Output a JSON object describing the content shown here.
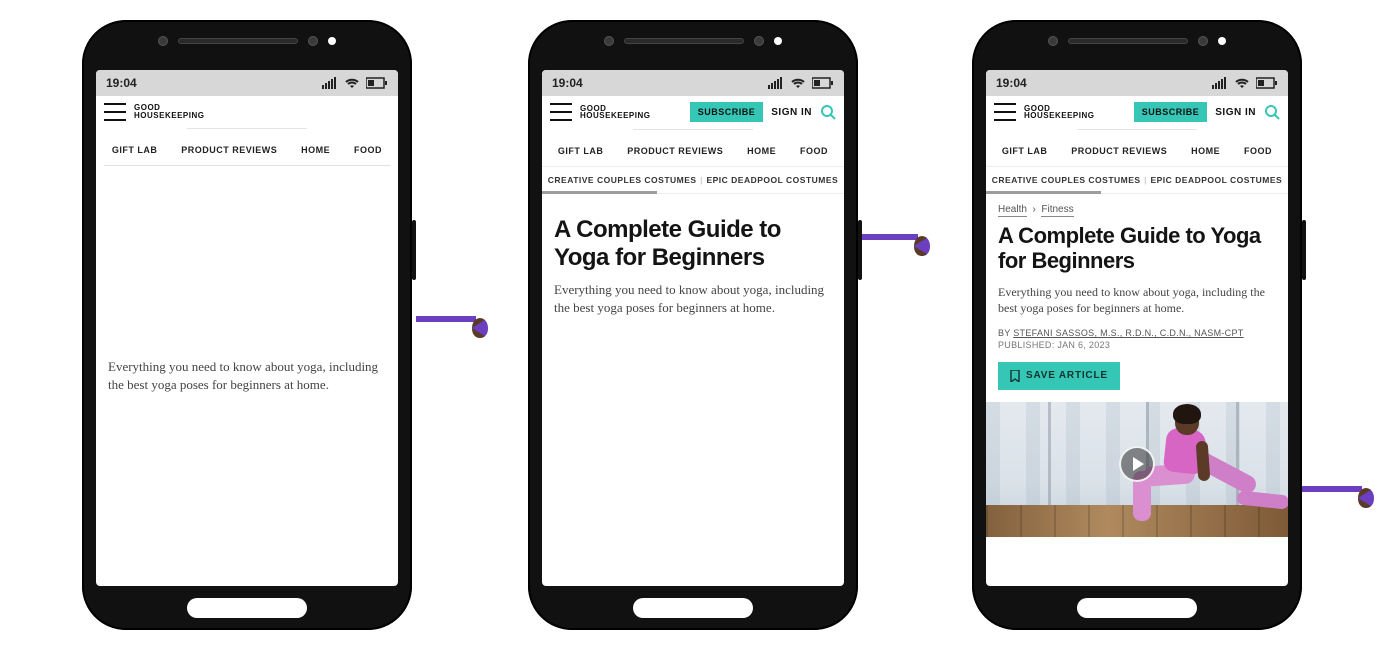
{
  "status": {
    "time": "19:04"
  },
  "brand": {
    "line1": "GOOD",
    "line2": "HOUSEKEEPING"
  },
  "header": {
    "subscribe": "SUBSCRIBE",
    "signin": "SIGN IN"
  },
  "nav": {
    "primary": [
      "GIFT LAB",
      "PRODUCT REVIEWS",
      "HOME",
      "FOOD"
    ],
    "secondary": [
      "CREATIVE COUPLES COSTUMES",
      "EPIC DEADPOOL COSTUMES"
    ]
  },
  "article": {
    "breadcrumb": [
      "Health",
      "Fitness"
    ],
    "title": "A Complete Guide to Yoga for Beginners",
    "lede": "Everything you need to know about yoga, including the best yoga poses for beginners at home.",
    "by_prefix": "BY ",
    "author": "STEFANI SASSOS, M.S., R.D.N., C.D.N., NASM-CPT",
    "published_prefix": "PUBLISHED: ",
    "published": "JAN 6, 2023",
    "save": "SAVE ARTICLE"
  },
  "colors": {
    "accent": "#36c6b6",
    "arrow": "#6b3fbf"
  }
}
